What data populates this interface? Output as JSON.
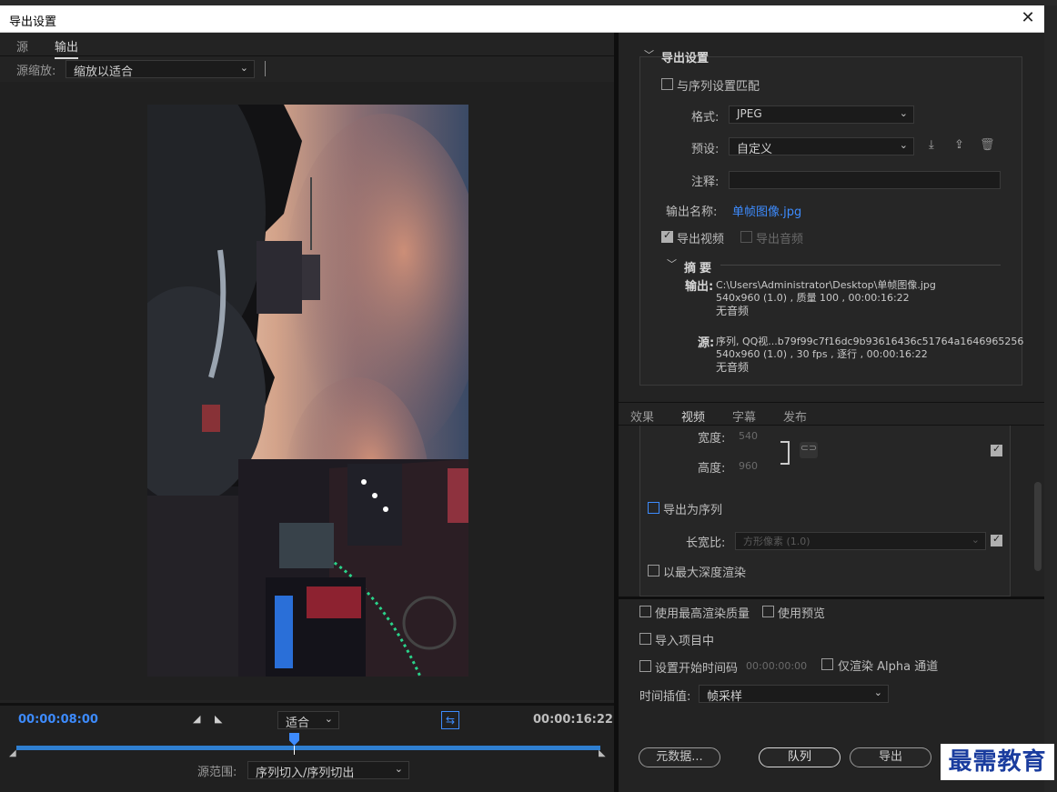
{
  "window": {
    "title": "导出设置",
    "close": "✕"
  },
  "left": {
    "tabs": [
      {
        "label": "源"
      },
      {
        "label": "输出"
      }
    ],
    "source_zoom_label": "源缩放:",
    "source_zoom_value": "缩放以适合",
    "timeline": {
      "current_time": "00:00:08:00",
      "end_time": "00:00:16:22",
      "fit_value": "适合",
      "range_label": "源范围:",
      "range_value": "序列切入/序列切出"
    }
  },
  "export": {
    "section_title": "导出设置",
    "match_sequence": "与序列设置匹配",
    "format_label": "格式:",
    "format_value": "JPEG",
    "preset_label": "预设:",
    "preset_value": "自定义",
    "comment_label": "注释:",
    "comment_value": "",
    "output_name_label": "输出名称:",
    "output_name_value": "单帧图像.jpg",
    "export_video": "导出视频",
    "export_audio": "导出音频",
    "summary_title": "摘要",
    "summary_output_label": "输出:",
    "summary_output_line1": "C:\\Users\\Administrator\\Desktop\\单帧图像.jpg",
    "summary_output_line2": "540x960  (1.0) ,  质量 100 ,  00:00:16:22",
    "summary_output_line3": "无音频",
    "summary_source_label": "源:",
    "summary_source_line1": "序列, QQ视...b79f99c7f16dc9b93616436c51764a1646965256",
    "summary_source_line2": "540x960  (1.0) ,  30 fps ,  逐行 ,  00:00:16:22",
    "summary_source_line3": "无音频"
  },
  "video_tabs": [
    {
      "label": "效果"
    },
    {
      "label": "视频"
    },
    {
      "label": "字幕"
    },
    {
      "label": "发布"
    }
  ],
  "video": {
    "width_label": "宽度:",
    "width_value": "540",
    "height_label": "高度:",
    "height_value": "960",
    "export_as_sequence": "导出为序列",
    "aspect_label": "长宽比:",
    "aspect_value": "方形像素 (1.0)",
    "max_depth": "以最大深度渲染"
  },
  "bottom": {
    "max_quality": "使用最高渲染质量",
    "use_preview": "使用预览",
    "import_project": "导入项目中",
    "set_start_tc": "设置开始时间码",
    "start_tc_value": "00:00:00:00",
    "alpha_only": "仅渲染 Alpha 通道",
    "interp_label": "时间插值:",
    "interp_value": "帧采样",
    "btn_metadata": "元数据...",
    "btn_queue": "队列",
    "btn_export": "导出",
    "btn_cancel": "取消"
  },
  "watermark": "最需教育",
  "colors": {
    "accent": "#3d8bfd",
    "timeline_bar": "#2f7fd0"
  }
}
